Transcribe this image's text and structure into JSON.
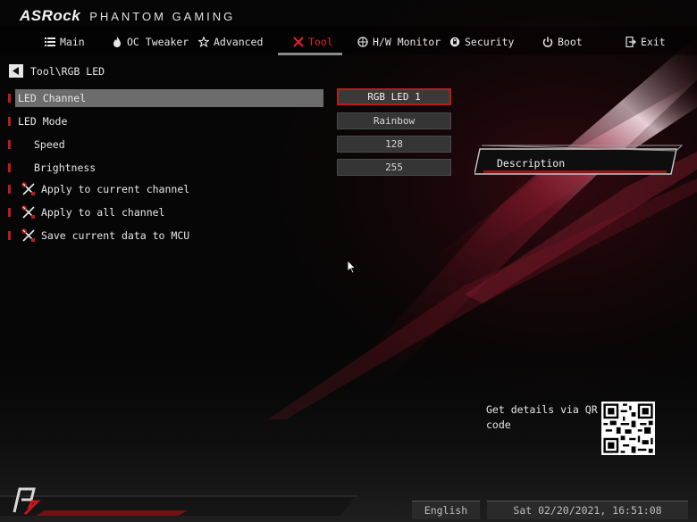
{
  "brand": {
    "logo": "ASRock",
    "subtitle": "PHANTOM GAMING"
  },
  "nav": {
    "items": [
      {
        "id": "main",
        "label": "Main",
        "icon": "list-icon"
      },
      {
        "id": "oc",
        "label": "OC Tweaker",
        "icon": "flame-icon"
      },
      {
        "id": "advanced",
        "label": "Advanced",
        "icon": "star-icon"
      },
      {
        "id": "tool",
        "label": "Tool",
        "icon": "tools-icon",
        "active": true
      },
      {
        "id": "hw",
        "label": "H/W Monitor",
        "icon": "monitor-icon"
      },
      {
        "id": "security",
        "label": "Security",
        "icon": "shield-icon"
      },
      {
        "id": "boot",
        "label": "Boot",
        "icon": "power-icon"
      },
      {
        "id": "exit",
        "label": "Exit",
        "icon": "exit-icon"
      }
    ]
  },
  "breadcrumb": "Tool\\RGB LED",
  "settings": [
    {
      "label": "LED Channel",
      "value": "RGB LED 1"
    },
    {
      "label": "LED Mode",
      "value": "Rainbow"
    },
    {
      "label": "Speed",
      "value": "128"
    },
    {
      "label": "Brightness",
      "value": "255"
    }
  ],
  "actions": [
    {
      "label": "Apply to current channel",
      "icon": "wrench-icon"
    },
    {
      "label": "Apply to all channel",
      "icon": "wrench-icon"
    },
    {
      "label": "Save current data to MCU",
      "icon": "wrench-icon"
    }
  ],
  "description": {
    "title": "Description"
  },
  "qr": {
    "text": "Get details via QR code"
  },
  "footer": {
    "language": "English",
    "datetime": "Sat 02/20/2021, 16:51:08"
  },
  "colors": {
    "accent": "#c01a1a",
    "active_nav": "#e02424",
    "selected_row": "#6c6c6c"
  }
}
